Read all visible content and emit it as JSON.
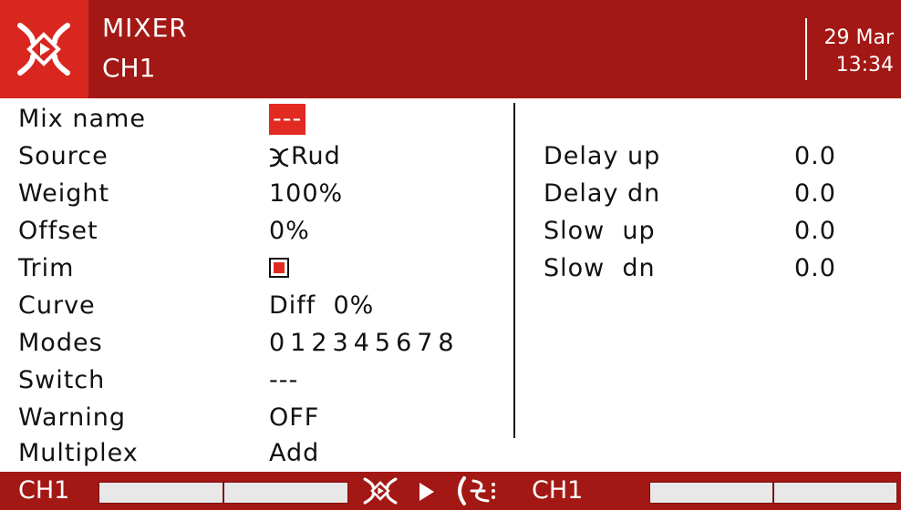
{
  "header": {
    "title": "MIXER",
    "subtitle": "CH1",
    "date": "29 Mar",
    "time": "13:34",
    "logo_icon": "edgetx-logo-icon"
  },
  "left_fields": [
    {
      "label": "Mix name",
      "value": "---"
    },
    {
      "label": "Source",
      "value": "Rud",
      "icon": "stick-source-icon"
    },
    {
      "label": "Weight",
      "value": "100%"
    },
    {
      "label": "Offset",
      "value": "0%"
    },
    {
      "label": "Trim",
      "value": "",
      "checked": true
    },
    {
      "label": "Curve",
      "value": "Diff  0%"
    },
    {
      "label": "Modes",
      "value": "012345678"
    },
    {
      "label": "Switch",
      "value": "---"
    },
    {
      "label": "Warning",
      "value": "OFF"
    },
    {
      "label": "Multiplex",
      "value": "Add"
    }
  ],
  "right_fields": [
    {
      "label": "Delay up",
      "value": "0.0"
    },
    {
      "label": "Delay dn",
      "value": "0.0"
    },
    {
      "label": "Slow  up",
      "value": "0.0"
    },
    {
      "label": "Slow  dn",
      "value": "0.0"
    }
  ],
  "footer": {
    "left_channel": "CH1",
    "right_channel": "CH1",
    "left_bar_fraction": 0.5,
    "right_bar_fraction": 0.5
  },
  "colors": {
    "header_bg": "#a31814",
    "accent": "#e12a22",
    "logo_bg": "#d9271f"
  }
}
